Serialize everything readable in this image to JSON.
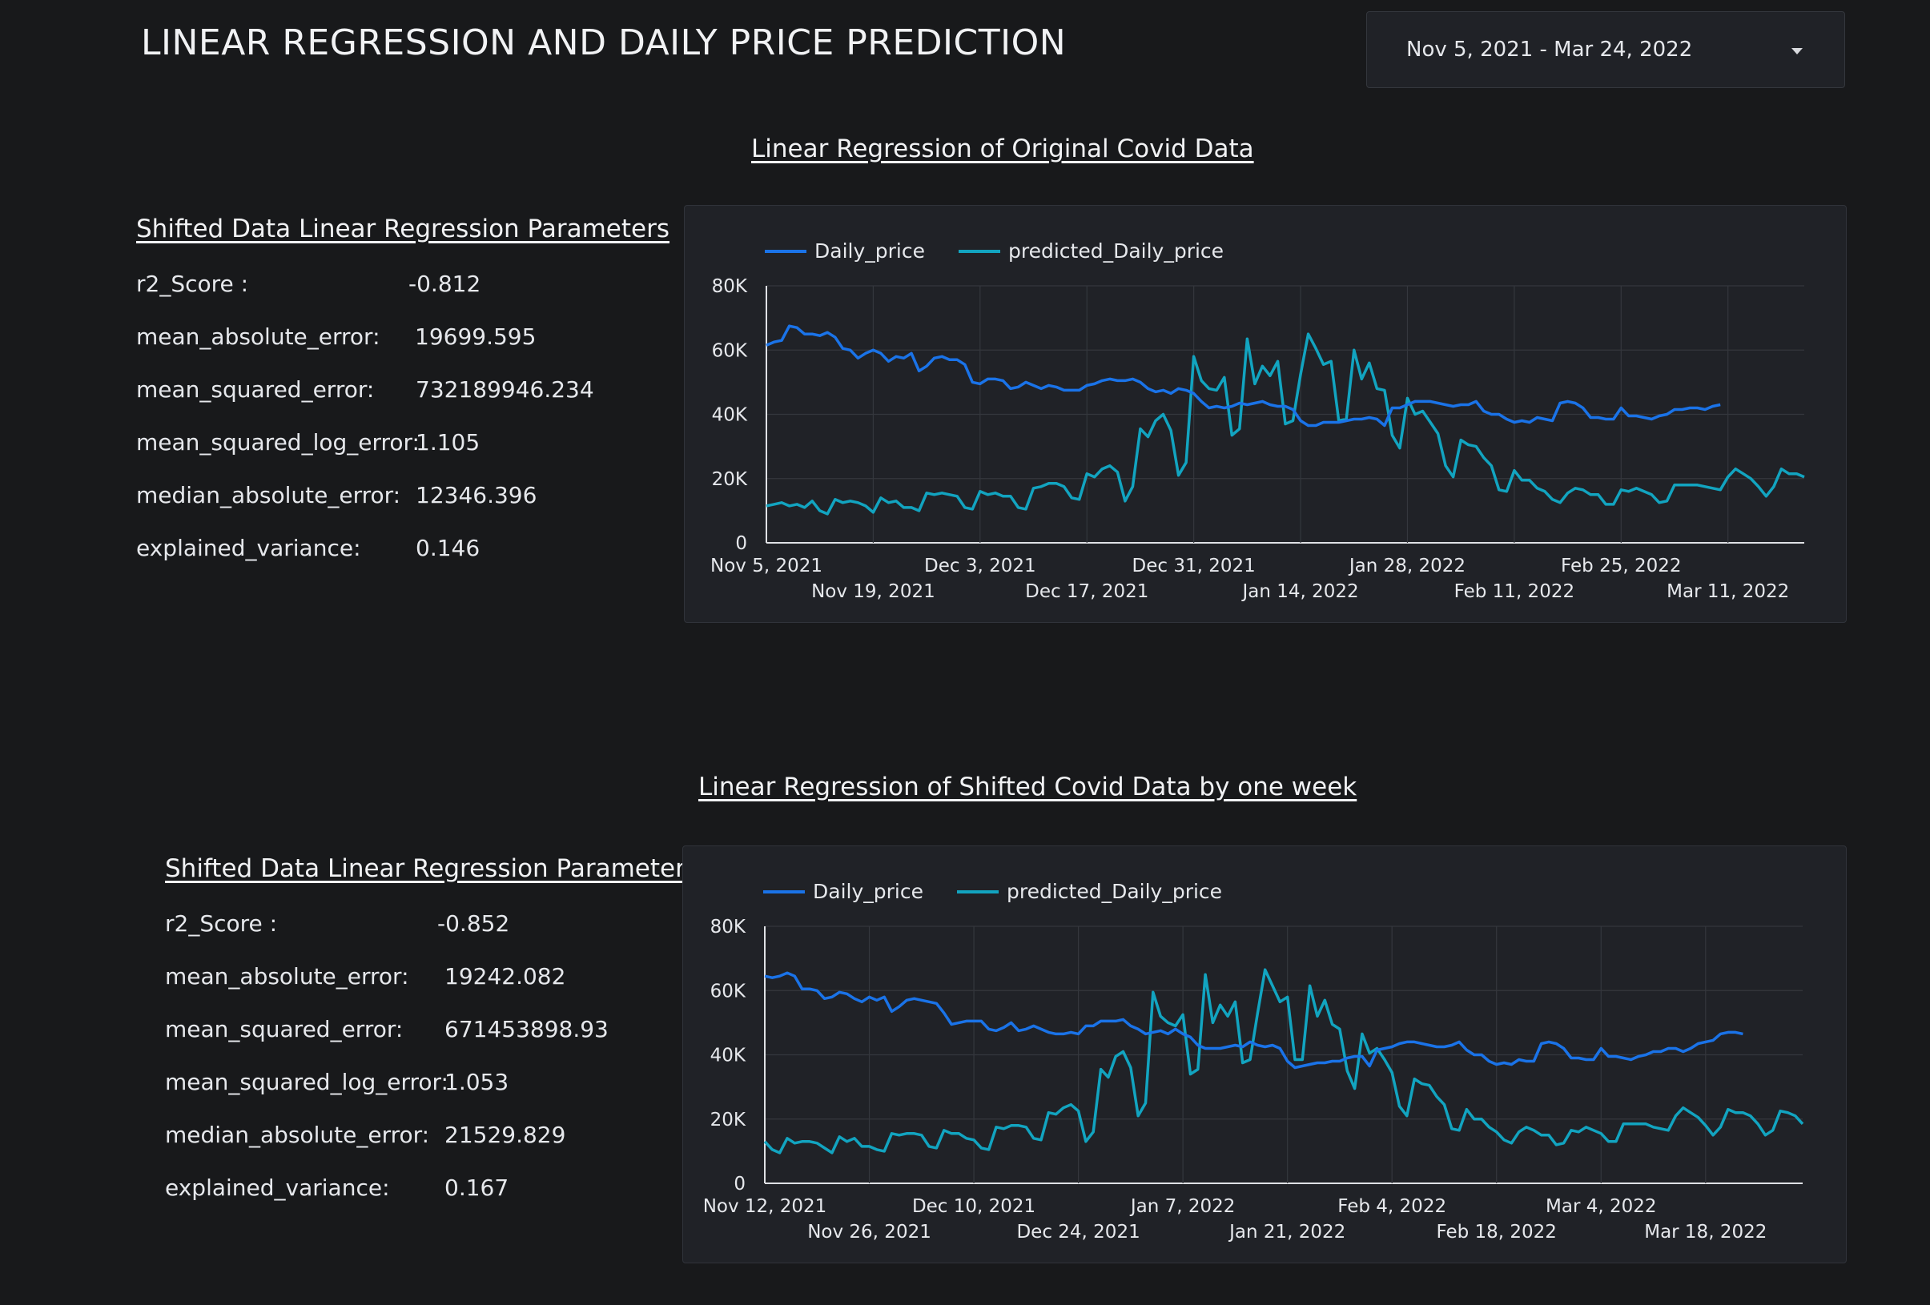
{
  "header": {
    "title": "LINEAR REGRESSION AND DAILY PRICE PREDICTION",
    "date_range": "Nov 5, 2021 - Mar 24, 2022"
  },
  "colors": {
    "actual": "#1a73e8",
    "predicted": "#12a4c0",
    "background": "#18191b",
    "panel": "#202227"
  },
  "section1": {
    "title": "Linear Regression of Original Covid Data",
    "params_title": "Shifted Data Linear Regression Parameters",
    "params": [
      {
        "label": "r2_Score :",
        "value": "-0.812"
      },
      {
        "label": "mean_absolute_error:",
        "value": "19699.595"
      },
      {
        "label": "mean_squared_error:",
        "value": "732189946.234"
      },
      {
        "label": "mean_squared_log_error:",
        "value": "1.105"
      },
      {
        "label": "median_absolute_error:",
        "value": "12346.396"
      },
      {
        "label": "explained_variance:",
        "value": "0.146"
      }
    ]
  },
  "section2": {
    "title": "Linear Regression of Shifted Covid Data by one week",
    "params_title": "Shifted Data Linear Regression Parameters",
    "params": [
      {
        "label": "r2_Score :",
        "value": "-0.852"
      },
      {
        "label": "mean_absolute_error:",
        "value": "19242.082"
      },
      {
        "label": "mean_squared_error:",
        "value": "671453898.93"
      },
      {
        "label": "mean_squared_log_error:",
        "value": "1.053"
      },
      {
        "label": "median_absolute_error:",
        "value": "21529.829"
      },
      {
        "label": "explained_variance:",
        "value": "0.167"
      }
    ]
  },
  "chart_data": [
    {
      "type": "line",
      "x_start": "2021-11-05",
      "x_end": "2022-03-24",
      "x_tick_labels": [
        "Nov 5, 2021",
        "Nov 19, 2021",
        "Dec 3, 2021",
        "Dec 17, 2021",
        "Dec 31, 2021",
        "Jan 14, 2022",
        "Jan 28, 2022",
        "Feb 11, 2022",
        "Feb 25, 2022",
        "Mar 11, 2022"
      ],
      "y_tick_labels": [
        "0",
        "20K",
        "40K",
        "60K",
        "80K"
      ],
      "ylim": [
        0,
        80000
      ],
      "grid": true,
      "legend": "top-left",
      "series": [
        {
          "name": "Daily_price",
          "color": "#1a73e8",
          "values": [
            61500,
            62500,
            63000,
            67500,
            67000,
            65000,
            65000,
            64500,
            65500,
            64000,
            60500,
            60000,
            57500,
            59000,
            60000,
            59000,
            56500,
            58000,
            57500,
            59000,
            53500,
            55000,
            57500,
            58000,
            57000,
            57000,
            55500,
            50000,
            49500,
            51000,
            51000,
            50500,
            48000,
            48500,
            50000,
            49000,
            48000,
            49000,
            48500,
            47500,
            47500,
            47500,
            49000,
            49500,
            50500,
            51000,
            50500,
            50500,
            51000,
            50000,
            48000,
            47000,
            47500,
            46500,
            48000,
            47500,
            46500,
            44000,
            42000,
            42500,
            42000,
            42500,
            43500,
            43000,
            43500,
            44000,
            43000,
            42500,
            42500,
            41500,
            38000,
            36500,
            36500,
            37500,
            37500,
            37500,
            38000,
            38500,
            38500,
            39000,
            38500,
            36500,
            42000,
            42000,
            43000,
            44000,
            44000,
            44000,
            43500,
            43000,
            42500,
            43000,
            43000,
            44000,
            41000,
            40000,
            40000,
            38500,
            37500,
            38000,
            37500,
            39000,
            38500,
            38000,
            43500,
            44000,
            43500,
            42000,
            39000,
            39000,
            38500,
            38500,
            42000,
            39500,
            39500,
            39000,
            38500,
            39500,
            40000,
            41500,
            41500,
            42000,
            42000,
            41500,
            42500,
            43000
          ]
        },
        {
          "name": "predicted_Daily_price",
          "color": "#12a4c0",
          "values": [
            11500,
            12000,
            12500,
            11500,
            12000,
            11000,
            13000,
            10000,
            9000,
            13500,
            12500,
            13000,
            12500,
            11500,
            9500,
            14000,
            12500,
            13000,
            11000,
            11000,
            10000,
            15500,
            15000,
            15500,
            15000,
            14500,
            11000,
            10500,
            16000,
            15000,
            15500,
            14500,
            14500,
            11000,
            10500,
            17000,
            17500,
            18500,
            18500,
            17500,
            14000,
            13500,
            21500,
            20500,
            23000,
            24000,
            22000,
            13000,
            17500,
            35500,
            33000,
            38000,
            40000,
            35000,
            21000,
            25000,
            58000,
            50500,
            48000,
            47500,
            51500,
            33500,
            35500,
            63500,
            49500,
            55000,
            52000,
            56500,
            37000,
            38000,
            52500,
            65000,
            60500,
            55500,
            56500,
            38000,
            38500,
            60000,
            51000,
            56000,
            48000,
            47500,
            33500,
            29500,
            45000,
            40000,
            41000,
            37500,
            34000,
            24000,
            20500,
            32000,
            30500,
            30000,
            26500,
            24000,
            16500,
            16000,
            22500,
            19500,
            19500,
            17000,
            16000,
            13500,
            12500,
            15500,
            17000,
            16500,
            15000,
            15000,
            12000,
            12000,
            16500,
            16000,
            17000,
            16000,
            15000,
            12500,
            13000,
            18000,
            18000,
            18000,
            18000,
            17500,
            17000,
            16500,
            20500,
            23000,
            21500,
            20000,
            17500,
            14500,
            17500,
            23000,
            21500,
            21500,
            20500
          ]
        }
      ]
    },
    {
      "type": "line",
      "x_start": "2021-11-12",
      "x_end": "2022-03-31",
      "x_tick_labels": [
        "Nov 12, 2021",
        "Nov 26, 2021",
        "Dec 10, 2021",
        "Dec 24, 2021",
        "Jan 7, 2022",
        "Jan 21, 2022",
        "Feb 4, 2022",
        "Feb 18, 2022",
        "Mar 4, 2022",
        "Mar 18, 2022"
      ],
      "y_tick_labels": [
        "0",
        "20K",
        "40K",
        "60K",
        "80K"
      ],
      "ylim": [
        0,
        80000
      ],
      "grid": true,
      "legend": "top-left",
      "series": [
        {
          "name": "Daily_price",
          "color": "#1a73e8",
          "values": [
            64500,
            64000,
            64500,
            65500,
            64500,
            60500,
            60500,
            60000,
            57500,
            58000,
            59500,
            59000,
            57500,
            56500,
            58000,
            57000,
            58000,
            53500,
            55000,
            57000,
            57500,
            57000,
            56500,
            56000,
            53000,
            49500,
            50000,
            50500,
            50500,
            50500,
            48000,
            47500,
            48500,
            50000,
            47500,
            48000,
            49000,
            48000,
            47000,
            46500,
            46500,
            47000,
            46500,
            49000,
            49000,
            50500,
            50500,
            50500,
            51000,
            49000,
            48000,
            46500,
            47000,
            47500,
            46500,
            48000,
            46500,
            45500,
            43000,
            42000,
            42000,
            42000,
            42500,
            43000,
            42500,
            44000,
            43000,
            42500,
            43000,
            42000,
            38000,
            36000,
            36500,
            37000,
            37500,
            37500,
            38000,
            38000,
            39000,
            39500,
            39500,
            36500,
            41500,
            42000,
            42500,
            43500,
            44000,
            44000,
            43500,
            43000,
            42500,
            42500,
            43000,
            44000,
            41500,
            40000,
            40000,
            38000,
            37000,
            37500,
            37000,
            38500,
            38000,
            38000,
            43500,
            44000,
            43500,
            42000,
            39000,
            39000,
            38500,
            38500,
            42000,
            39500,
            39500,
            39000,
            38500,
            39500,
            40000,
            41000,
            41000,
            42000,
            42000,
            41000,
            42000,
            43500,
            44000,
            44500,
            46500,
            47000,
            47000,
            46500
          ]
        },
        {
          "name": "predicted_Daily_price",
          "color": "#12a4c0",
          "values": [
            13000,
            10500,
            9500,
            14000,
            12500,
            13000,
            13000,
            12500,
            11000,
            9500,
            14500,
            13000,
            14000,
            11500,
            11500,
            10500,
            10000,
            15500,
            15000,
            15500,
            15500,
            15000,
            11500,
            11000,
            16500,
            15500,
            15500,
            14000,
            13500,
            11000,
            10500,
            17500,
            17000,
            18000,
            18000,
            17500,
            14000,
            13500,
            22000,
            21500,
            23500,
            24500,
            22500,
            13000,
            16000,
            35500,
            33000,
            39500,
            41000,
            36000,
            21000,
            25000,
            59500,
            52000,
            50000,
            49000,
            52500,
            34000,
            35500,
            65000,
            50000,
            55500,
            52000,
            56500,
            37500,
            38500,
            53000,
            66500,
            61500,
            56500,
            58000,
            38500,
            38500,
            61500,
            52000,
            57000,
            49500,
            48000,
            35000,
            29500,
            46500,
            40500,
            42000,
            38500,
            34500,
            24000,
            21000,
            32500,
            31000,
            30500,
            27000,
            24500,
            17000,
            16500,
            23000,
            20000,
            20000,
            17500,
            16000,
            13500,
            12500,
            16000,
            17500,
            16500,
            15000,
            15000,
            12000,
            12500,
            16500,
            16000,
            17500,
            16500,
            15500,
            13000,
            13000,
            18500,
            18500,
            18500,
            18500,
            17500,
            17000,
            16500,
            21000,
            23500,
            22000,
            20500,
            18000,
            15000,
            17500,
            23000,
            22000,
            22000,
            21000,
            18500,
            15000,
            16500,
            22500,
            22000,
            21000,
            18500
          ]
        }
      ]
    }
  ]
}
